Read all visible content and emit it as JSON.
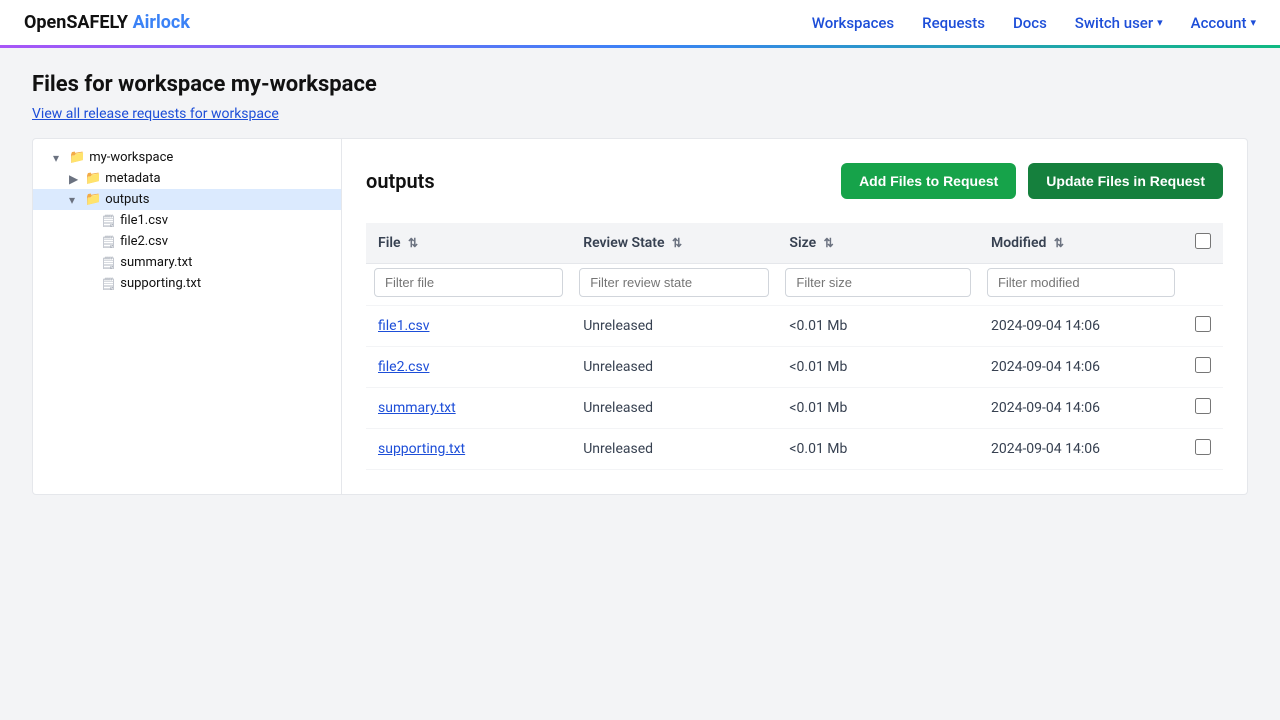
{
  "brand": {
    "prefix": "OpenSAFELY",
    "suffix": "Airlock"
  },
  "nav": {
    "links": [
      {
        "label": "Workspaces",
        "href": "#"
      },
      {
        "label": "Requests",
        "href": "#"
      },
      {
        "label": "Docs",
        "href": "#"
      }
    ],
    "switch_user": "Switch user",
    "account": "Account"
  },
  "page": {
    "title": "Files for workspace my-workspace",
    "subtitle": "View all release requests for workspace"
  },
  "buttons": {
    "add": "Add Files to Request",
    "update": "Update Files in Request"
  },
  "panel_title": "outputs",
  "table": {
    "columns": [
      "File",
      "Review State",
      "Size",
      "Modified"
    ],
    "filters": {
      "file": "Filter file",
      "review_state": "Filter review state",
      "size": "Filter size",
      "modified": "Filter modified"
    },
    "rows": [
      {
        "file": "file1.csv",
        "review_state": "Unreleased",
        "size": "<0.01 Mb",
        "modified": "2024-09-04 14:06"
      },
      {
        "file": "file2.csv",
        "review_state": "Unreleased",
        "size": "<0.01 Mb",
        "modified": "2024-09-04 14:06"
      },
      {
        "file": "summary.txt",
        "review_state": "Unreleased",
        "size": "<0.01 Mb",
        "modified": "2024-09-04 14:06"
      },
      {
        "file": "supporting.txt",
        "review_state": "Unreleased",
        "size": "<0.01 Mb",
        "modified": "2024-09-04 14:06"
      }
    ]
  },
  "sidebar": {
    "items": [
      {
        "label": "my-workspace",
        "type": "folder",
        "indent": 0,
        "expanded": true
      },
      {
        "label": "metadata",
        "type": "folder",
        "indent": 1,
        "expanded": false
      },
      {
        "label": "outputs",
        "type": "folder",
        "indent": 1,
        "expanded": true,
        "active": true
      },
      {
        "label": "file1.csv",
        "type": "file",
        "indent": 2
      },
      {
        "label": "file2.csv",
        "type": "file",
        "indent": 2
      },
      {
        "label": "summary.txt",
        "type": "file",
        "indent": 2
      },
      {
        "label": "supporting.txt",
        "type": "file",
        "indent": 2
      }
    ]
  }
}
